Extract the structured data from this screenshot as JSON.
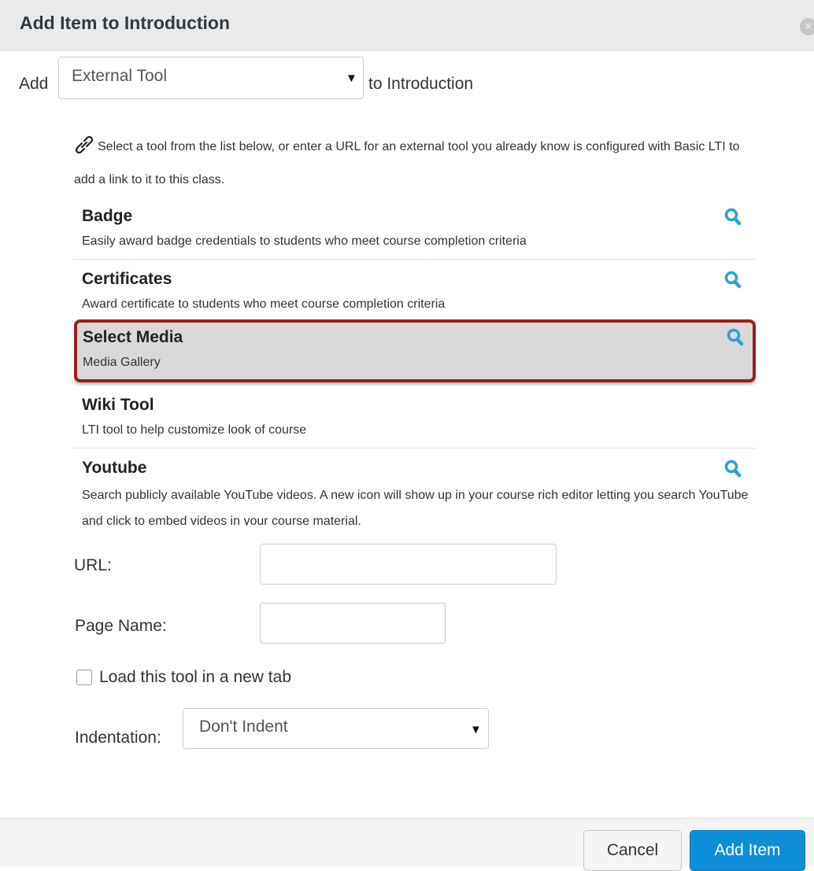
{
  "dialog": {
    "title": "Add Item to Introduction",
    "close_glyph": "×"
  },
  "add_row": {
    "add_label": "Add",
    "type_selected": "External Tool",
    "to_label": "to Introduction"
  },
  "help_text": "Select a tool from the list below, or enter a URL for an external tool you already know is configured with Basic LTI to add a link to it to this class.",
  "tools": [
    {
      "name": "Badge",
      "description": "Easily award badge credentials to students who meet course completion criteria"
    },
    {
      "name": "Certificates",
      "description": "Award certificate to students who meet course completion criteria"
    },
    {
      "name": "Select Media",
      "description": "Media Gallery",
      "selected": true
    },
    {
      "name": "Wiki Tool",
      "description": "LTI tool to help customize look of course"
    },
    {
      "name": "Youtube",
      "description": "Search publicly available YouTube videos. A new icon will show up in your course rich editor letting you search YouTube and click to embed videos in your course material."
    }
  ],
  "form": {
    "url_label": "URL:",
    "url_value": "",
    "page_name_label": "Page Name:",
    "page_name_value": "",
    "new_tab_label": "Load this tool in a new tab",
    "new_tab_checked": false,
    "indentation_label": "Indentation:",
    "indentation_selected": "Don't Indent"
  },
  "footer": {
    "cancel_label": "Cancel",
    "add_label": "Add Item"
  },
  "colors": {
    "primary_button": "#0e8ed7",
    "highlight_border": "#a11c1c",
    "search_icon": "#2d9fd9"
  },
  "icons": {
    "link": "link-icon",
    "search": "magnifier-icon",
    "dropdown": "caret-down-icon",
    "close": "close-icon"
  }
}
